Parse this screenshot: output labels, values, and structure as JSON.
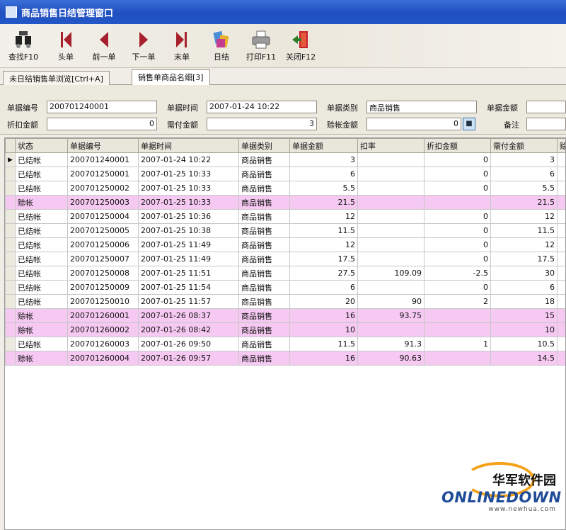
{
  "window": {
    "title": "商品销售日结管理窗口"
  },
  "toolbar": {
    "buttons": [
      {
        "label": "查找F10",
        "icon": "search-binoculars-icon"
      },
      {
        "label": "头单",
        "icon": "first-record-icon"
      },
      {
        "label": "前一单",
        "icon": "previous-record-icon"
      },
      {
        "label": "下一单",
        "icon": "next-record-icon"
      },
      {
        "label": "末单",
        "icon": "last-record-icon"
      },
      {
        "label": "日结",
        "icon": "daily-settle-icon"
      },
      {
        "label": "打印F11",
        "icon": "printer-icon"
      },
      {
        "label": "关闭F12",
        "icon": "exit-door-icon"
      }
    ]
  },
  "tabs": [
    {
      "label": "未日结销售单浏览[Ctrl+A]"
    },
    {
      "label": "销售单商品名细[3]"
    }
  ],
  "form": {
    "doc_no_label": "单据编号",
    "doc_no": "200701240001",
    "doc_time_label": "单据时间",
    "doc_time": "2007-01-24 10:22",
    "doc_type_label": "单据类别",
    "doc_type": "商品销售",
    "doc_amount_label": "单据金额",
    "doc_amount": "",
    "discount_label": "折扣金额",
    "discount": "0",
    "payable_label": "需付金额",
    "payable": "3",
    "credit_label": "赊帐金额",
    "credit": "0",
    "remark_label": "备注",
    "remark": ""
  },
  "grid": {
    "columns": [
      "状态",
      "单据编号",
      "单据时间",
      "单据类别",
      "单据金额",
      "扣率",
      "折扣金额",
      "需付金额",
      "赊"
    ],
    "rows": [
      {
        "status": "已结帐",
        "no": "200701240001",
        "time": "2007-01-24 10:22",
        "type": "商品销售",
        "amount": "3",
        "rate": "",
        "discount": "0",
        "payable": "3",
        "reverse": false,
        "current": true
      },
      {
        "status": "已结帐",
        "no": "200701250001",
        "time": "2007-01-25 10:33",
        "type": "商品销售",
        "amount": "6",
        "rate": "",
        "discount": "0",
        "payable": "6",
        "reverse": false
      },
      {
        "status": "已结帐",
        "no": "200701250002",
        "time": "2007-01-25 10:33",
        "type": "商品销售",
        "amount": "5.5",
        "rate": "",
        "discount": "0",
        "payable": "5.5",
        "reverse": false
      },
      {
        "status": "赊帐",
        "no": "200701250003",
        "time": "2007-01-25 10:33",
        "type": "商品销售",
        "amount": "21.5",
        "rate": "",
        "discount": "",
        "payable": "21.5",
        "reverse": true
      },
      {
        "status": "已结帐",
        "no": "200701250004",
        "time": "2007-01-25 10:36",
        "type": "商品销售",
        "amount": "12",
        "rate": "",
        "discount": "0",
        "payable": "12",
        "reverse": false
      },
      {
        "status": "已结帐",
        "no": "200701250005",
        "time": "2007-01-25 10:38",
        "type": "商品销售",
        "amount": "11.5",
        "rate": "",
        "discount": "0",
        "payable": "11.5",
        "reverse": false
      },
      {
        "status": "已结帐",
        "no": "200701250006",
        "time": "2007-01-25 11:49",
        "type": "商品销售",
        "amount": "12",
        "rate": "",
        "discount": "0",
        "payable": "12",
        "reverse": false
      },
      {
        "status": "已结帐",
        "no": "200701250007",
        "time": "2007-01-25 11:49",
        "type": "商品销售",
        "amount": "17.5",
        "rate": "",
        "discount": "0",
        "payable": "17.5",
        "reverse": false
      },
      {
        "status": "已结帐",
        "no": "200701250008",
        "time": "2007-01-25 11:51",
        "type": "商品销售",
        "amount": "27.5",
        "rate": "109.09",
        "discount": "-2.5",
        "payable": "30",
        "reverse": false
      },
      {
        "status": "已结帐",
        "no": "200701250009",
        "time": "2007-01-25 11:54",
        "type": "商品销售",
        "amount": "6",
        "rate": "",
        "discount": "0",
        "payable": "6",
        "reverse": false
      },
      {
        "status": "已结帐",
        "no": "200701250010",
        "time": "2007-01-25 11:57",
        "type": "商品销售",
        "amount": "20",
        "rate": "90",
        "discount": "2",
        "payable": "18",
        "reverse": false
      },
      {
        "status": "赊帐",
        "no": "200701260001",
        "time": "2007-01-26 08:37",
        "type": "商品销售",
        "amount": "16",
        "rate": "93.75",
        "discount": "",
        "payable": "15",
        "reverse": true
      },
      {
        "status": "赊帐",
        "no": "200701260002",
        "time": "2007-01-26 08:42",
        "type": "商品销售",
        "amount": "10",
        "rate": "",
        "discount": "",
        "payable": "10",
        "reverse": true
      },
      {
        "status": "已结帐",
        "no": "200701260003",
        "time": "2007-01-26 09:50",
        "type": "商品销售",
        "amount": "11.5",
        "rate": "91.3",
        "discount": "1",
        "payable": "10.5",
        "reverse": false
      },
      {
        "status": "赊帐",
        "no": "200701260004",
        "time": "2007-01-26 09:57",
        "type": "商品销售",
        "amount": "16",
        "rate": "90.63",
        "discount": "",
        "payable": "14.5",
        "reverse": true
      }
    ]
  },
  "watermark": {
    "cn": "华军软件园",
    "en": "ONLINEDOWN",
    "url": "www.newhua.com"
  },
  "colors": {
    "credit_row": "#f6c9f2",
    "title_bar": "#1f4fbf"
  }
}
